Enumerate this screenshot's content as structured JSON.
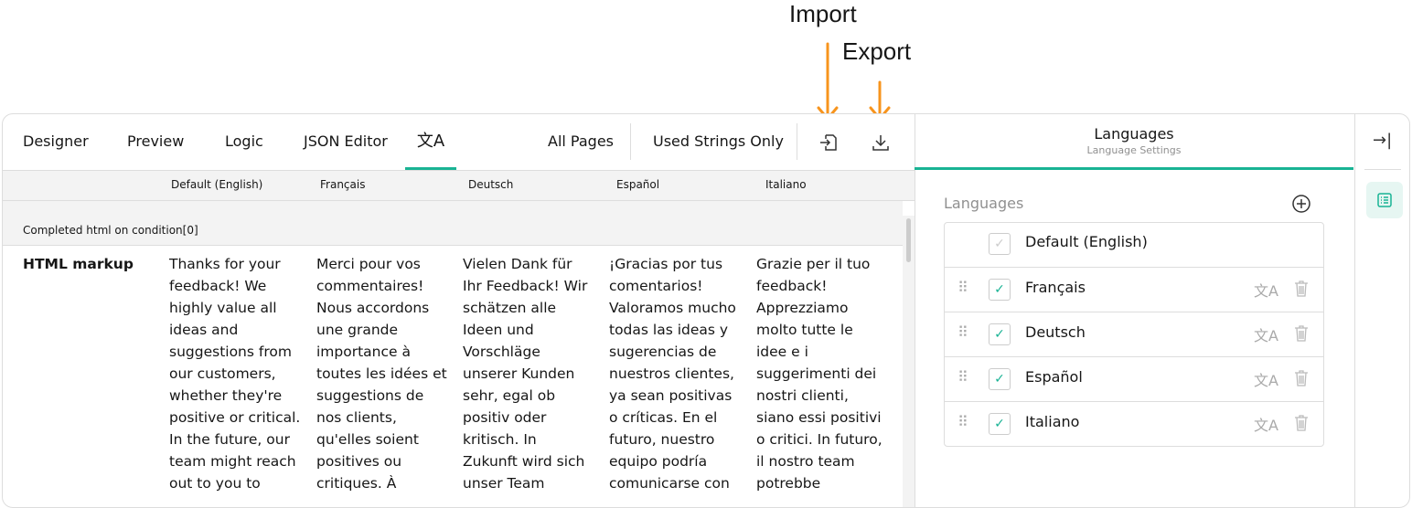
{
  "annotations": {
    "import": "Import",
    "export": "Export",
    "arrow_color": "#f7941d"
  },
  "toolbar": {
    "tabs": [
      "Designer",
      "Preview",
      "Logic",
      "JSON Editor"
    ],
    "active_tab": "translation",
    "all_pages": "All Pages",
    "used_strings": "Used Strings Only",
    "import_icon": "import-icon",
    "export_icon": "download-icon"
  },
  "table": {
    "columns": [
      "Default (English)",
      "Français",
      "Deutsch",
      "Español",
      "Italiano"
    ],
    "group": "Completed html on condition[0]",
    "row_label": "HTML markup",
    "cells": [
      [
        "Thanks for your",
        "feedback! We",
        "highly value all",
        "ideas and",
        "suggestions from",
        "our customers,",
        "whether they're",
        "positive or critical.",
        "In the future, our",
        "team might reach",
        "out to you to"
      ],
      [
        "Merci pour vos",
        "commentaires!",
        "Nous accordons",
        "une grande",
        "importance à",
        "toutes les idées et",
        "suggestions de",
        "nos clients,",
        "qu'elles soient",
        "positives ou",
        "critiques. À"
      ],
      [
        "Vielen Dank für",
        "Ihr Feedback! Wir",
        "schätzen alle",
        "Ideen und",
        "Vorschläge",
        "unserer Kunden",
        "sehr, egal ob",
        "positiv oder",
        "kritisch. In",
        "Zukunft wird sich",
        "unser Team"
      ],
      [
        "¡Gracias por tus",
        "comentarios!",
        "Valoramos mucho",
        "todas las ideas y",
        "sugerencias de",
        "nuestros clientes,",
        "ya sean positivas",
        "o críticas. En el",
        "futuro, nuestro",
        "equipo podría",
        "comunicarse con"
      ],
      [
        "Grazie per il tuo",
        "feedback!",
        "Apprezziamo",
        "molto tutte le",
        "idee e i",
        "suggerimenti dei",
        "nostri clienti,",
        "siano essi positivi",
        "o critici. In futuro,",
        "il nostro team",
        "potrebbe"
      ]
    ]
  },
  "panel": {
    "title": "Languages",
    "subtitle": "Language Settings",
    "section": "Languages",
    "languages": [
      {
        "name": "Default (English)",
        "checked": true,
        "default": true
      },
      {
        "name": "Français",
        "checked": true
      },
      {
        "name": "Deutsch",
        "checked": true
      },
      {
        "name": "Español",
        "checked": true
      },
      {
        "name": "Italiano",
        "checked": true
      }
    ]
  },
  "colors": {
    "accent": "#19b394"
  }
}
